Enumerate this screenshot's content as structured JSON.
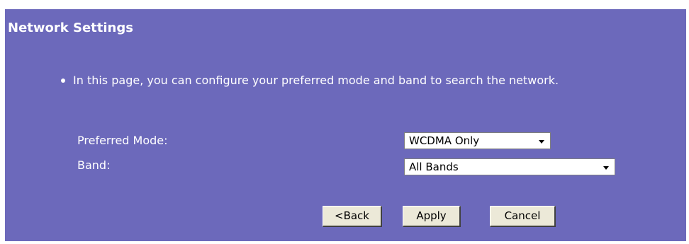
{
  "page": {
    "title": "Network Settings",
    "info": "In this page, you can configure your preferred mode and band to search the network."
  },
  "form": {
    "preferred_mode": {
      "label": "Preferred Mode:",
      "value": "WCDMA Only"
    },
    "band": {
      "label": "Band:",
      "value": "All Bands"
    }
  },
  "buttons": {
    "back": "<Back",
    "apply": "Apply",
    "cancel": "Cancel"
  },
  "colors": {
    "panel_background": "#6c69bb",
    "text": "#ffffff",
    "button_face": "#ece9d8"
  }
}
